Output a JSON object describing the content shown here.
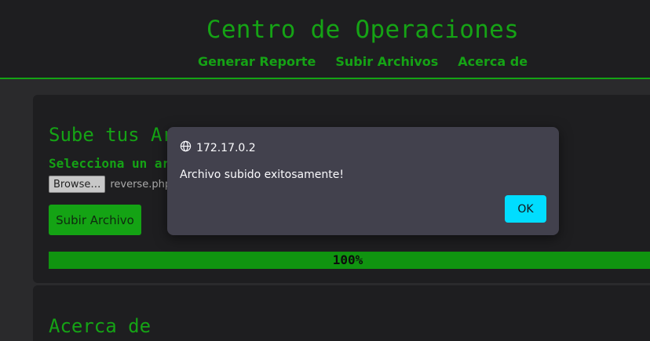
{
  "header": {
    "title": "Centro de Operaciones",
    "nav": [
      "Generar Reporte",
      "Subir Archivos",
      "Acerca de"
    ]
  },
  "upload": {
    "title": "Sube tus Ar",
    "select_label": "Selecciona un arc",
    "browse_label": "Browse…",
    "file_name": "reverse.php",
    "submit_label": "Subir Archivo",
    "progress_text": "100%",
    "progress": 1.0
  },
  "about": {
    "title": "Acerca de"
  },
  "dialog": {
    "origin": "172.17.0.2",
    "origin_icon": "globe-icon",
    "message": "Archivo subido exitosamente!",
    "ok_label": "OK"
  },
  "colors": {
    "accent": "#15a315",
    "dialog_bg": "#42414d",
    "ok_button": "#00ddff"
  }
}
